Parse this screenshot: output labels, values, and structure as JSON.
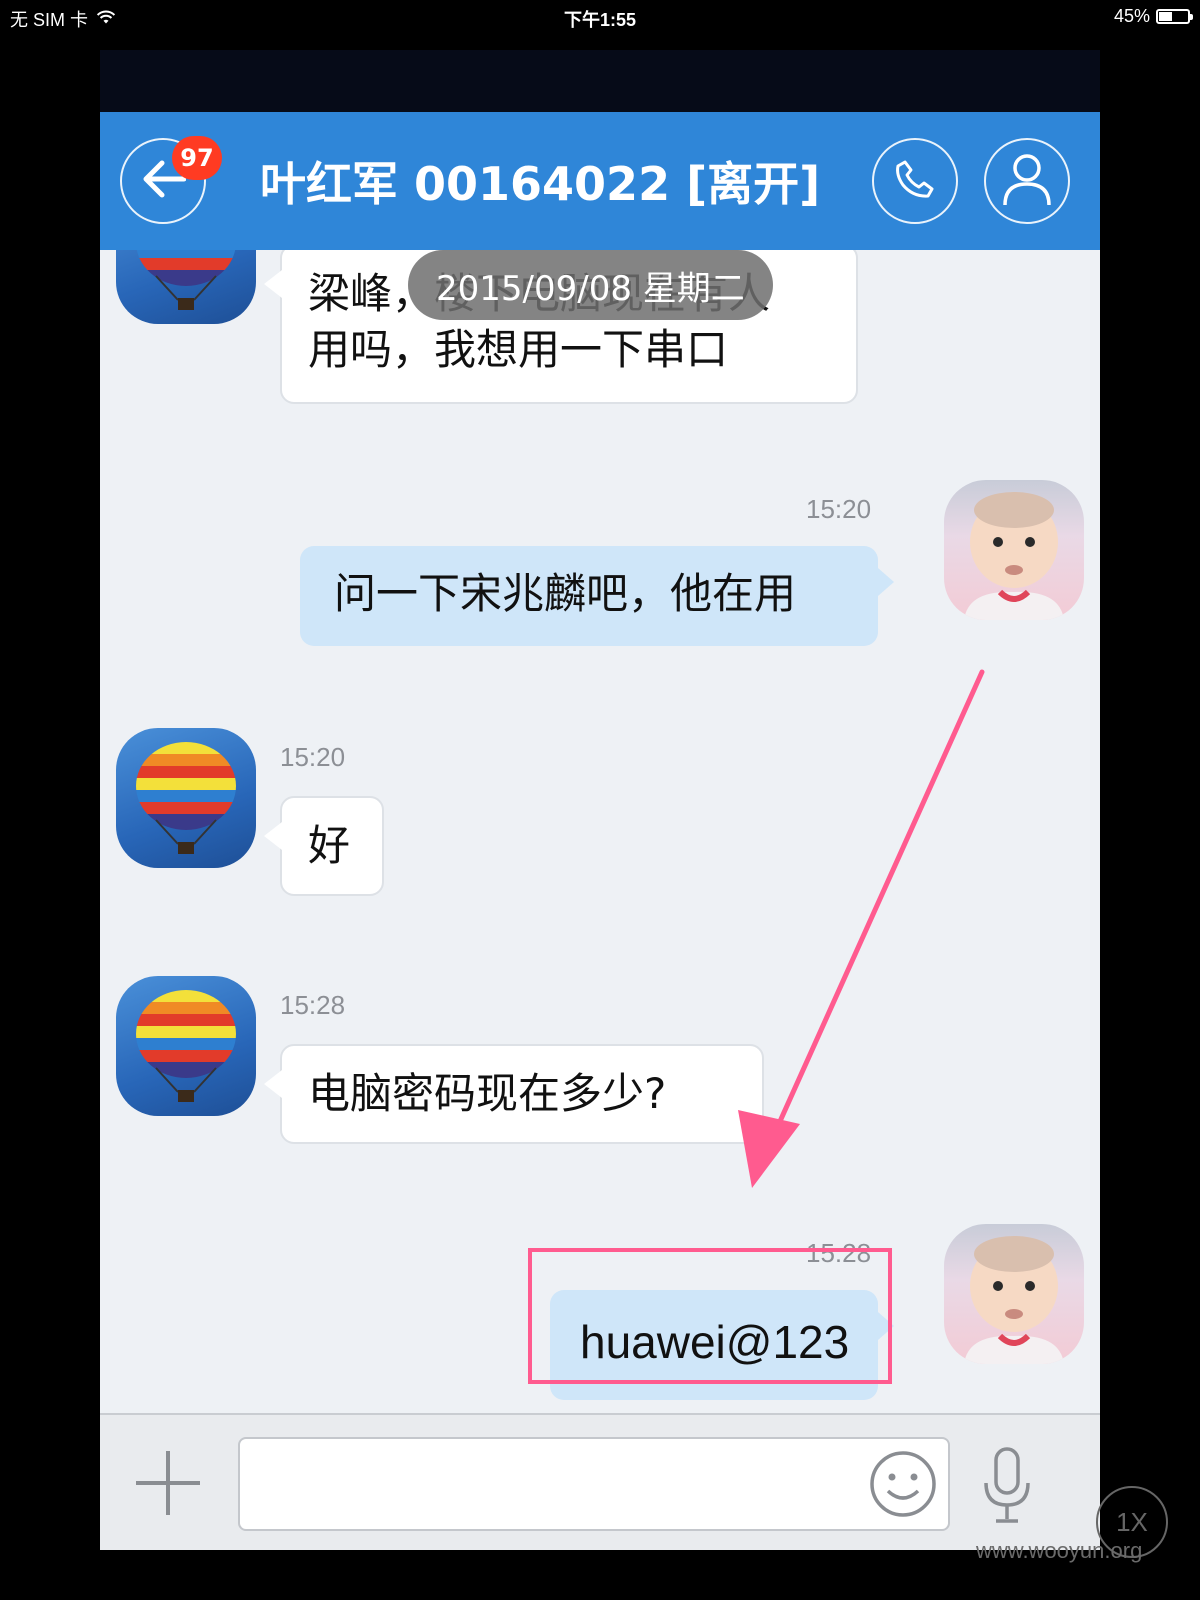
{
  "status_bar": {
    "carrier": "无 SIM 卡",
    "time": "下午1:55",
    "battery": "45%",
    "battery_level": 0.45
  },
  "header": {
    "badge": "97",
    "title": "叶红军 00164022 [离开]"
  },
  "date_divider": "2015/09/08 星期二",
  "messages": [
    {
      "direction": "in",
      "time": "",
      "lines": [
        "梁峰，楼下电脑现在有人",
        "用吗，我想用一下串口"
      ]
    },
    {
      "direction": "out",
      "time": "15:20",
      "lines": [
        "问一下宋兆麟吧，他在用"
      ]
    },
    {
      "direction": "in",
      "time": "15:20",
      "lines": [
        "好"
      ]
    },
    {
      "direction": "in",
      "time": "15:28",
      "lines": [
        "电脑密码现在多少?"
      ]
    },
    {
      "direction": "out",
      "time": "15:28",
      "lines": [
        "huawei@123"
      ]
    }
  ],
  "input": {
    "value": "",
    "placeholder": ""
  },
  "icons": {
    "back": "arrow-left-icon",
    "call": "phone-icon",
    "profile": "person-icon",
    "add": "plus-icon",
    "emoji": "smiley-icon",
    "voice": "microphone-icon"
  },
  "annotation": {
    "color": "#ff5b8f"
  },
  "watermark": {
    "badge": "1X",
    "text": "www.wooyun.org"
  }
}
